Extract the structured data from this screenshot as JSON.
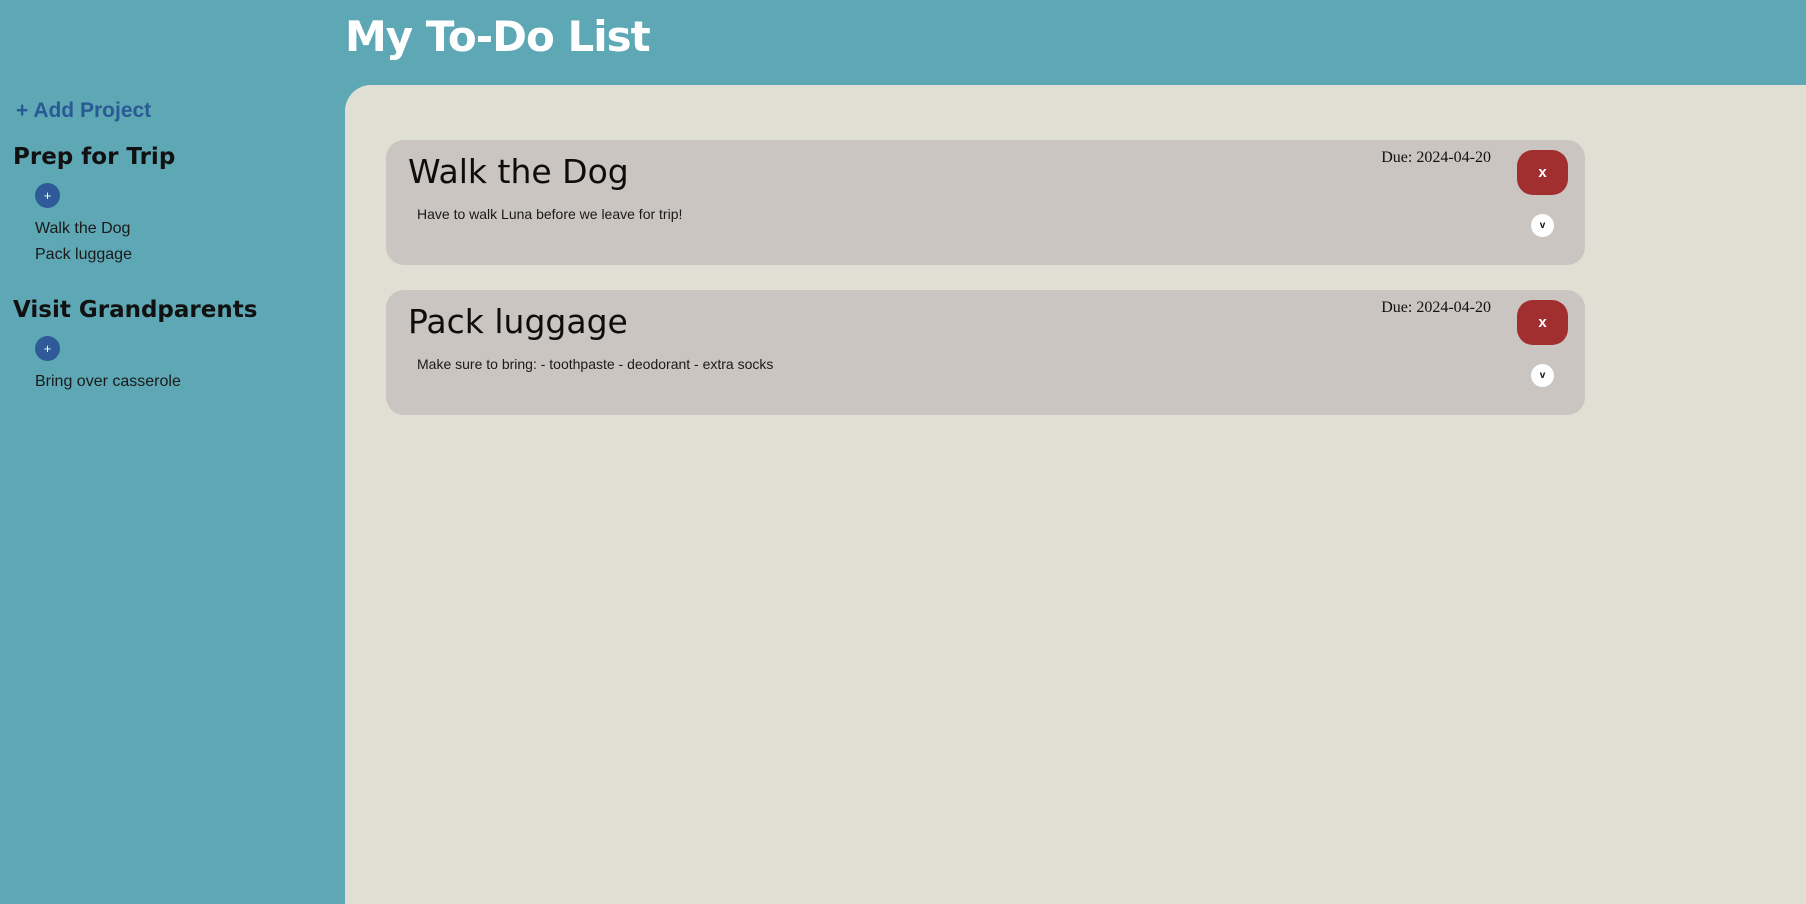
{
  "header": {
    "title": "My To-Do List"
  },
  "sidebar": {
    "add_project_label": "+ Add Project",
    "projects": [
      {
        "title": "Prep for Trip",
        "add_button_label": "+",
        "todos": [
          "Walk the Dog",
          "Pack luggage"
        ]
      },
      {
        "title": "Visit Grandparents",
        "add_button_label": "+",
        "todos": [
          "Bring over casserole"
        ]
      }
    ]
  },
  "main": {
    "cards": [
      {
        "title": "Walk the Dog",
        "description": "Have to walk Luna before we leave for trip!",
        "due": "Due: 2024-04-20",
        "delete_label": "x",
        "expand_label": "v"
      },
      {
        "title": "Pack luggage",
        "description": "Make sure to bring: - toothpaste - deodorant - extra socks",
        "due": "Due: 2024-04-20",
        "delete_label": "x",
        "expand_label": "v"
      }
    ]
  },
  "colors": {
    "sidebar_bg": "#5ea7b5",
    "main_bg": "#dfe0d3",
    "card_bg": "#cac5c1",
    "delete_button": "#a12f2f",
    "add_button": "#2e5a99",
    "add_project_text": "#2a5a93"
  },
  "icons": {
    "delete": "x-icon",
    "expand": "chevron-down-icon",
    "add": "plus-icon"
  }
}
